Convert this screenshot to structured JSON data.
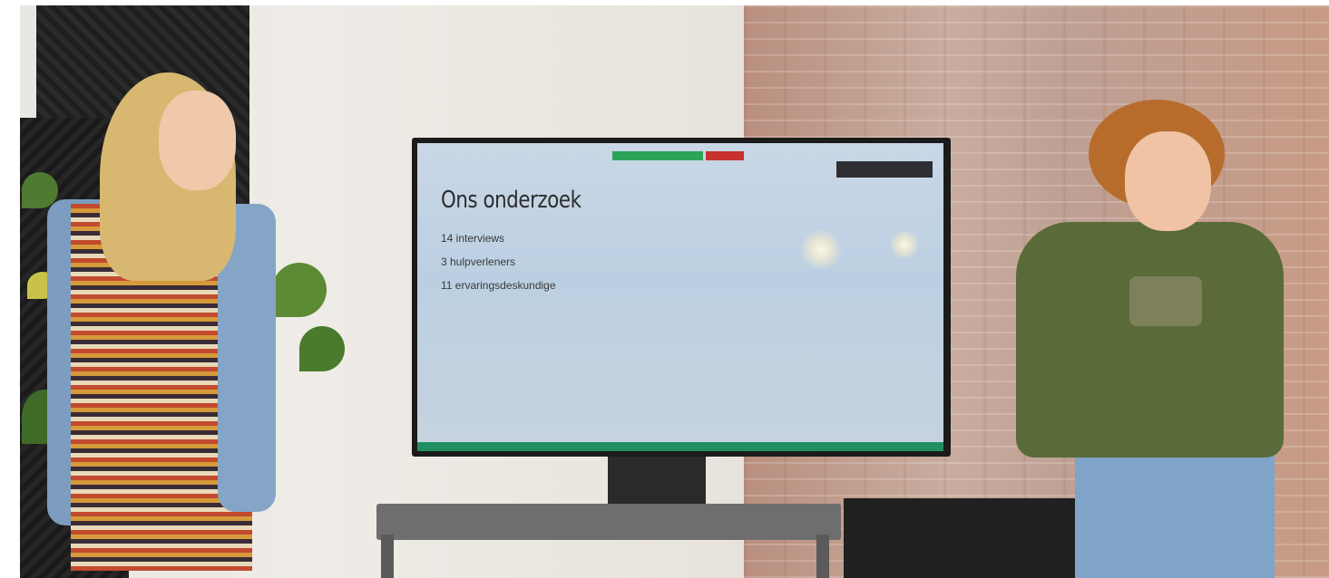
{
  "scene": {
    "description_type": "photo-of-presentation",
    "accent_colors": {
      "screen_bar": "#1f8f62",
      "share_bar": "#2ba45a",
      "stop_share": "#c8322e"
    }
  },
  "slide": {
    "title": "Ons onderzoek",
    "items": [
      "14 interviews",
      "3 hulpverleners",
      "11 ervaringsdeskundige"
    ]
  }
}
